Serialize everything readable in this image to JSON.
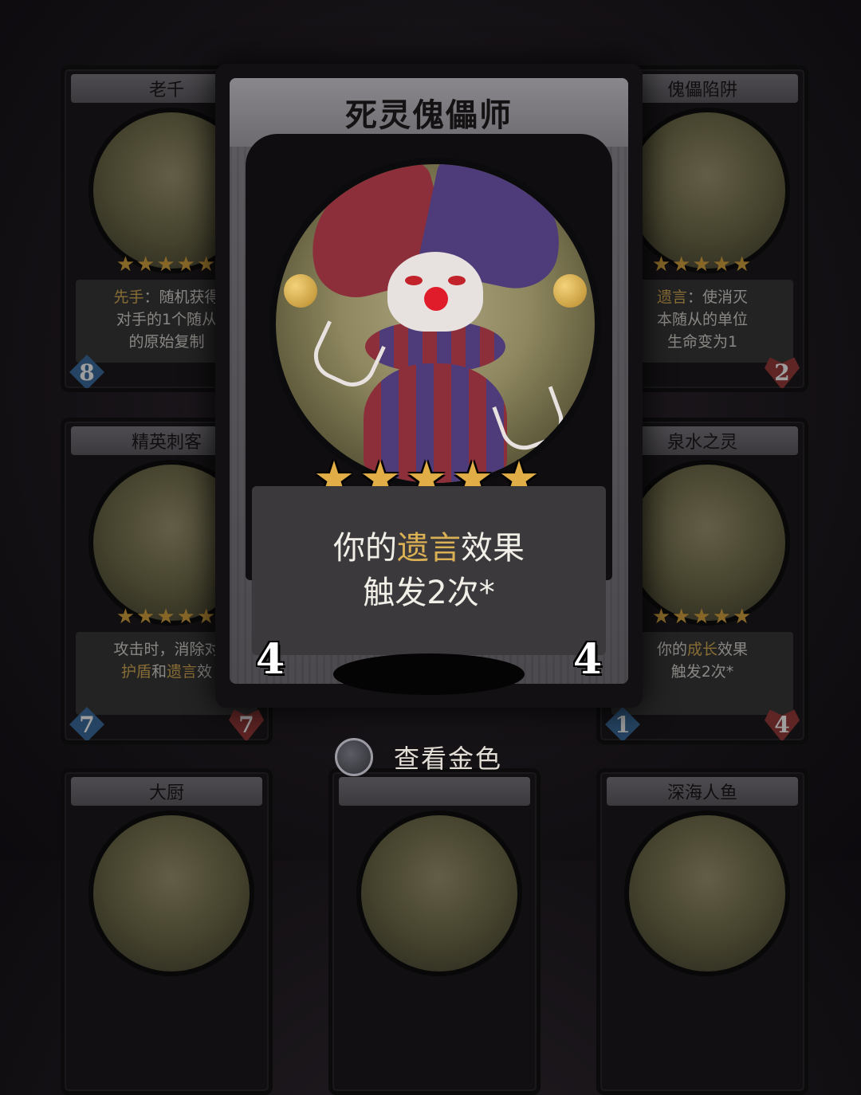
{
  "grid_cards": [
    {
      "name": "老千",
      "stars": "★★★★★",
      "desc": [
        "先手：随机获得",
        "对手的1个随从",
        "的原始复制"
      ],
      "cost": "8",
      "hp": ""
    },
    {
      "name": "傀儡陷阱",
      "stars": "★★★★★",
      "desc": [
        "遗言：使消灭",
        "本随从的单位",
        "生命变为1"
      ],
      "cost": "",
      "hp": "2"
    },
    {
      "name": "精英刺客",
      "stars": "★★★★★",
      "desc": [
        "攻击时，消除对",
        "护盾和遗言效"
      ],
      "cost": "7",
      "hp": "7"
    },
    {
      "name": "泉水之灵",
      "stars": "★★★★★",
      "desc": [
        "你的成长效果",
        "触发2次*"
      ],
      "cost": "1",
      "hp": "4"
    },
    {
      "name": "大厨",
      "stars": "",
      "desc": [],
      "cost": "",
      "hp": ""
    },
    {
      "name": "深海人鱼",
      "stars": "",
      "desc": [],
      "cost": "",
      "hp": ""
    }
  ],
  "featured": {
    "name": "死灵傀儡师",
    "stars": "★★★★★",
    "desc_line1_pre": "你的",
    "desc_line1_hl": "遗言",
    "desc_line1_post": "效果",
    "desc_line2": "触发2次*",
    "cost": "4",
    "hp": "4"
  },
  "toggle": {
    "label": "查看金色"
  },
  "colors": {
    "keyword": "#d9b054",
    "cost_badge": "#4678a8",
    "hp_badge": "#a54343",
    "star": "#e1ad46"
  }
}
